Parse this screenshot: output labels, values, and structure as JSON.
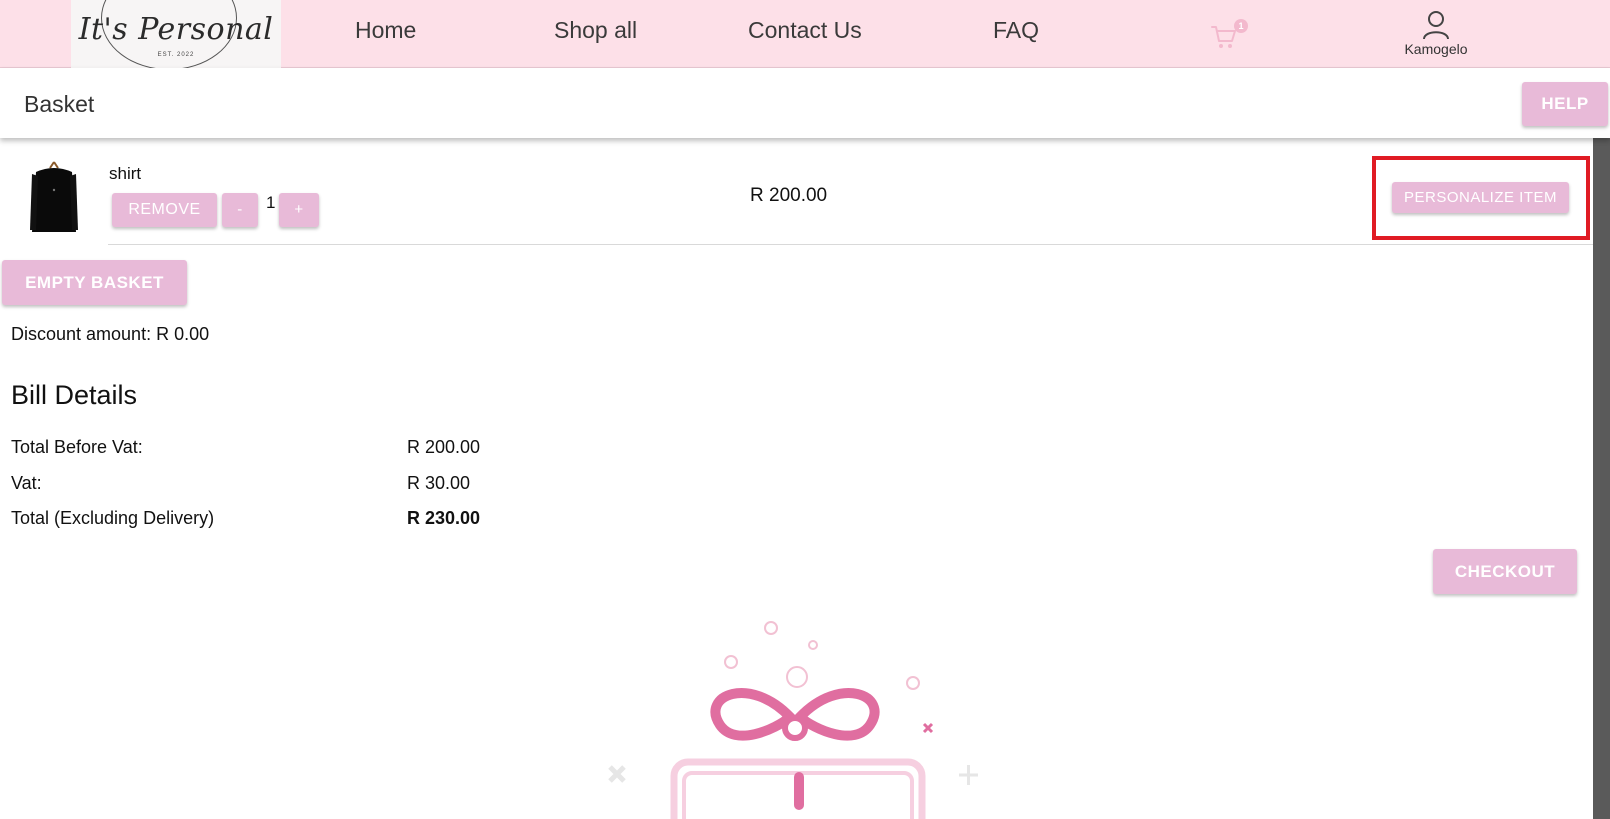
{
  "nav": {
    "logo_text": "It's Personal",
    "logo_est": "EST. 2022",
    "links": [
      "Home",
      "Shop all",
      "Contact Us",
      "FAQ"
    ],
    "cart_count": "1",
    "user_name": "Kamogelo"
  },
  "header": {
    "title": "Basket",
    "help_label": "HELP"
  },
  "basket": {
    "items": [
      {
        "name": "shirt",
        "remove_label": "REMOVE",
        "minus_label": "-",
        "quantity": "1",
        "plus_label": "+",
        "price": "R 200.00",
        "personalize_label": "PERSONALIZE ITEM"
      }
    ],
    "empty_label": "EMPTY BASKET",
    "discount_text": "Discount amount: R 0.00"
  },
  "bill": {
    "title": "Bill Details",
    "rows": [
      {
        "label": "Total Before Vat:",
        "value": "R 200.00"
      },
      {
        "label": "Vat:",
        "value": "R 30.00"
      },
      {
        "label": "Total (Excluding Delivery)",
        "value": "R 230.00"
      }
    ],
    "checkout_label": "CHECKOUT"
  },
  "colors": {
    "nav_bg": "#fde0e8",
    "button": "#e8bad8",
    "highlight": "#e01b24",
    "gift_pink": "#e06ea0"
  },
  "icons": [
    "cart-icon",
    "user-icon",
    "gift-illustration-icon"
  ]
}
